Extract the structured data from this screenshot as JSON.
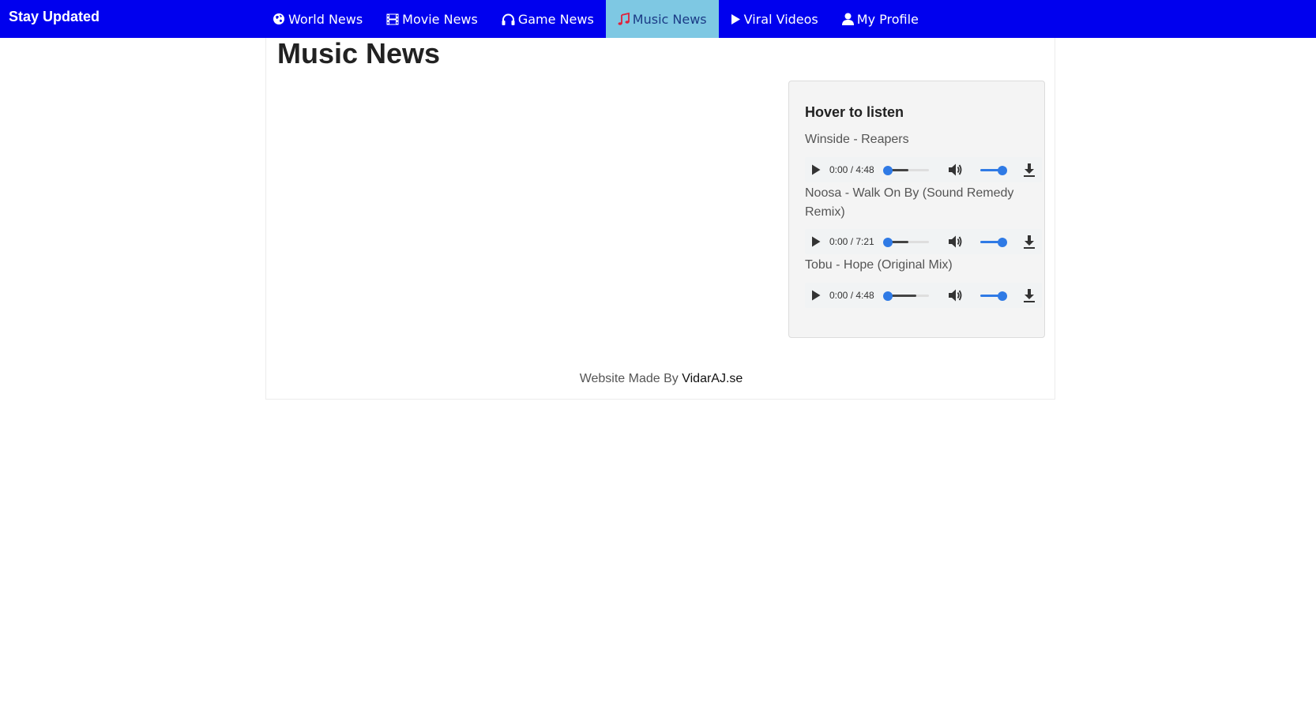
{
  "brand": "Stay Updated",
  "nav": {
    "items": [
      {
        "label": "World News",
        "icon": "globe-icon"
      },
      {
        "label": "Movie News",
        "icon": "film-icon"
      },
      {
        "label": "Game News",
        "icon": "headphones-icon"
      },
      {
        "label": "Music News",
        "icon": "music-note-icon",
        "active": true
      },
      {
        "label": "Viral Videos",
        "icon": "play-icon"
      },
      {
        "label": "My Profile",
        "icon": "user-icon"
      }
    ]
  },
  "page": {
    "title": "Music News"
  },
  "listen": {
    "heading": "Hover to listen",
    "tracks": [
      {
        "title": "Winside - Reapers",
        "time": "0:00 / 4:48",
        "buffered": 0.5
      },
      {
        "title": "Noosa - Walk On By (Sound Remedy Remix)",
        "time": "0:00 / 7:21",
        "buffered": 0.5
      },
      {
        "title": "Tobu - Hope (Original Mix)",
        "time": "0:00 / 4:48",
        "buffered": 0.7
      }
    ]
  },
  "footer": {
    "prefix": "Website Made By ",
    "link": "VidarAJ.se"
  },
  "colors": {
    "navbar": "#0000ee",
    "active_tab": "#7ec8e3",
    "music_icon": "#e0223b",
    "slider": "#2f7ae5"
  }
}
